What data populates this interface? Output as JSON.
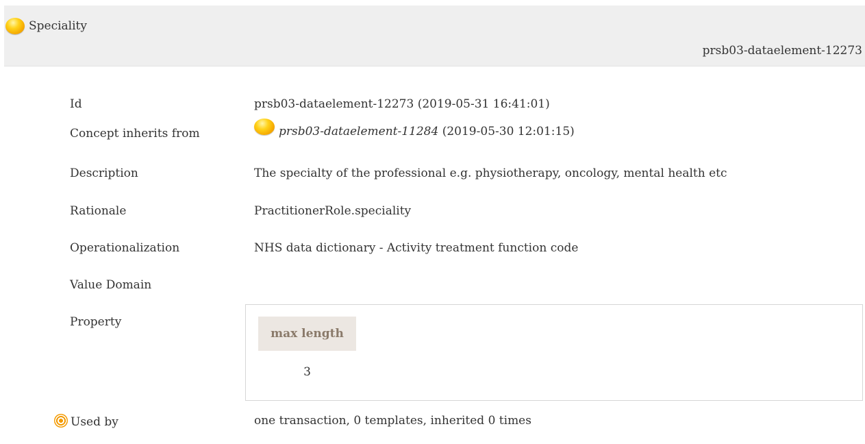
{
  "header": {
    "title": "Speciality",
    "id_right": "prsb03-dataelement-12273"
  },
  "rows": {
    "id": {
      "label": "Id",
      "value": "prsb03-dataelement-12273 (2019-05-31 16:41:01)"
    },
    "inherits": {
      "label": "Concept inherits from",
      "link": "prsb03-dataelement-11284",
      "suffix": " (2019-05-30 12:01:15)"
    },
    "description": {
      "label": "Description",
      "value": "The specialty of the professional e.g. physiotherapy, oncology, mental health etc"
    },
    "rationale": {
      "label": "Rationale",
      "value": "PractitionerRole.speciality"
    },
    "operationalization": {
      "label": "Operationalization",
      "value": "NHS data dictionary - Activity treatment function code"
    },
    "value_domain": {
      "label": "Value Domain"
    },
    "property": {
      "label": "Property",
      "column_header": "max length",
      "column_value": "3"
    },
    "used_by": {
      "label": "Used by",
      "value": "one transaction, 0 templates, inherited 0 times"
    }
  },
  "icons": {
    "concept_status": "yellow-orb-icon",
    "used_by": "target-icon"
  },
  "colors": {
    "header_bg": "#efefef",
    "property_header_bg": "#ece7e2",
    "property_header_text": "#8a7a6a",
    "orb": "#ffd21a"
  }
}
